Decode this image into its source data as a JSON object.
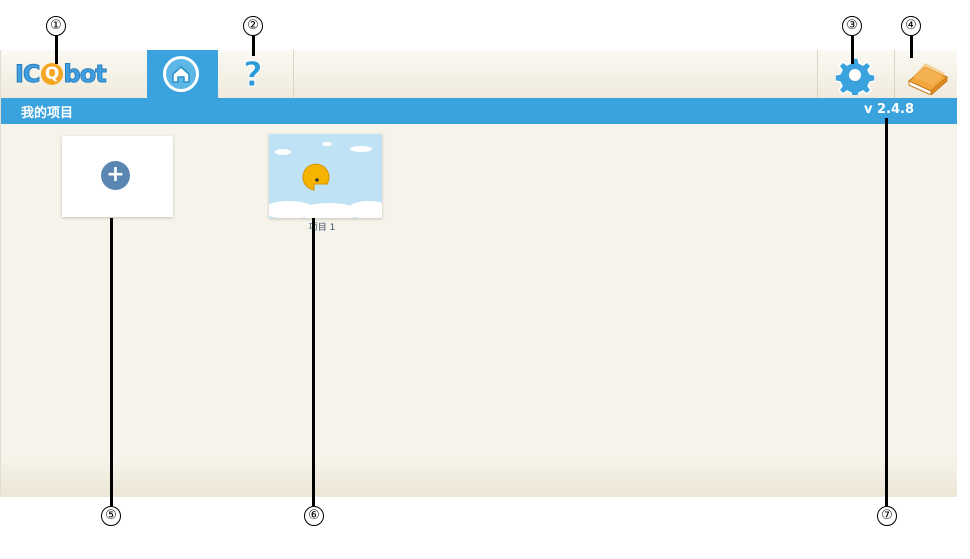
{
  "toolbar": {
    "logo_prefix": "IC",
    "logo_q": "Q",
    "logo_suffix": "bot",
    "help_label": "?"
  },
  "title_bar": {
    "title": "我的项目",
    "version": "v 2.4.8"
  },
  "projects": {
    "new_project_label": "+",
    "items": [
      {
        "name": "项目 1"
      }
    ]
  },
  "callouts": [
    "①",
    "②",
    "③",
    "④",
    "⑤",
    "⑥",
    "⑦"
  ],
  "colors": {
    "accent_blue": "#3aa3dd",
    "logo_orange": "#f5a623",
    "background": "#f6f3ea"
  }
}
